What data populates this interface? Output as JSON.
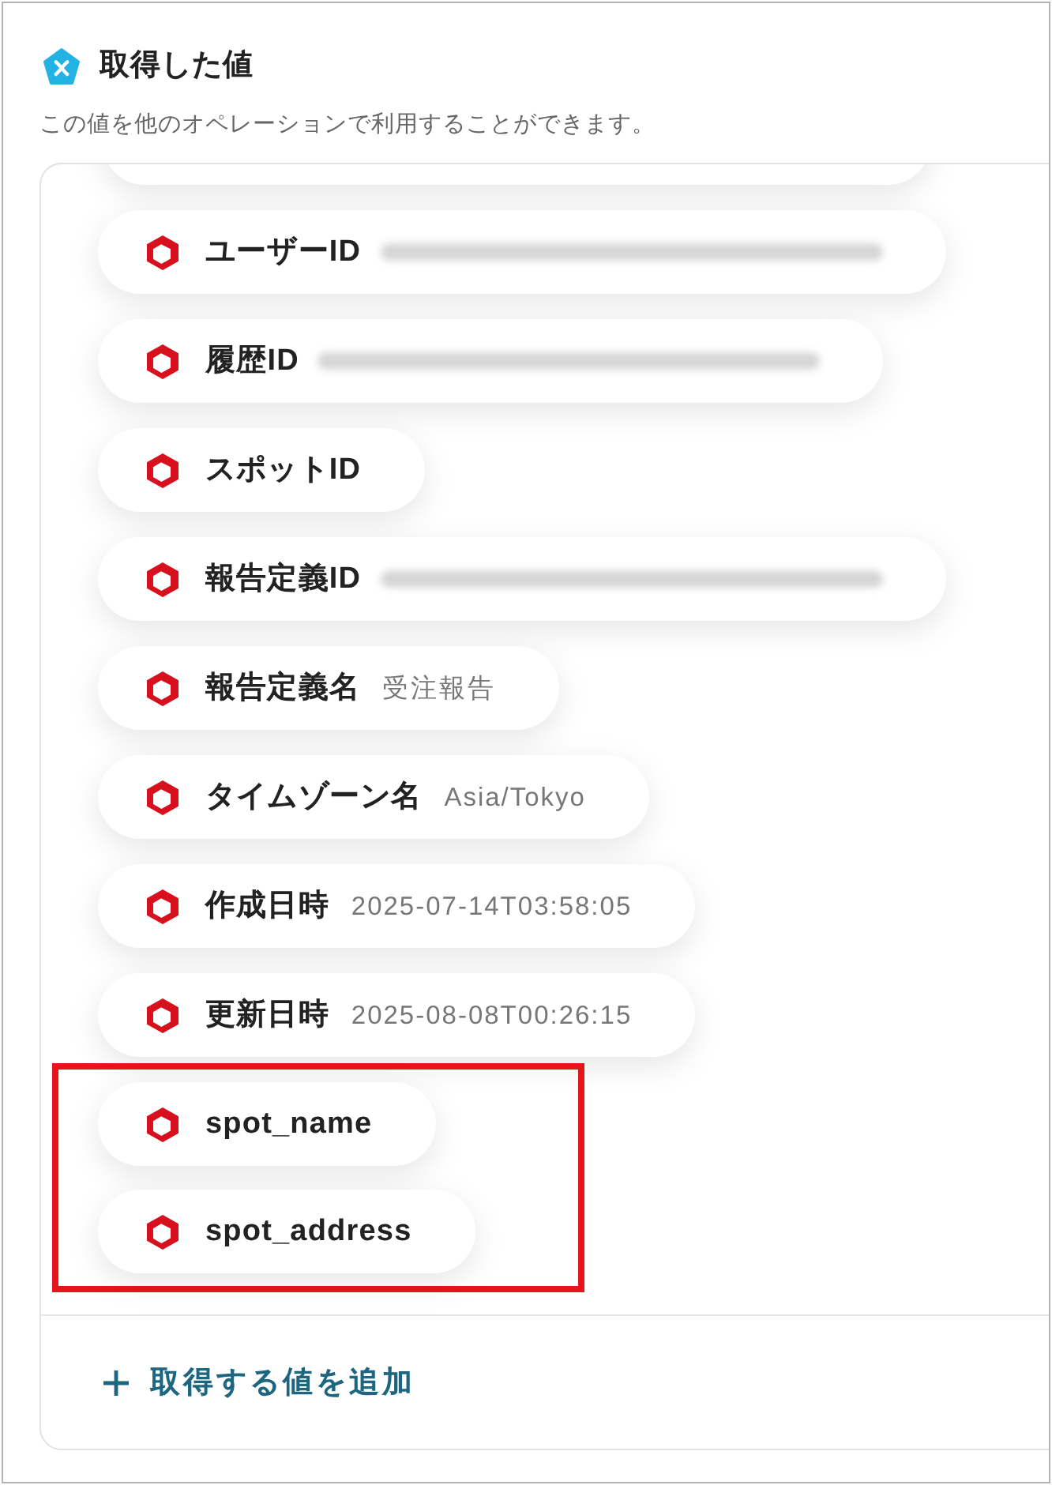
{
  "header": {
    "title": "取得した値",
    "description": "この値を他のオペレーションで利用することができます。"
  },
  "fields": [
    {
      "label": "ユーザーID",
      "value_blurred": true,
      "highlighted": false
    },
    {
      "label": "履歴ID",
      "value_blurred": true,
      "highlighted": false
    },
    {
      "label": "スポットID",
      "value_blurred": false,
      "highlighted": false
    },
    {
      "label": "報告定義ID",
      "value_blurred": true,
      "highlighted": false
    },
    {
      "label": "報告定義名",
      "value": "受注報告",
      "value_blurred": false,
      "highlighted": false
    },
    {
      "label": "タイムゾーン名",
      "value": "Asia/Tokyo",
      "value_blurred": false,
      "highlighted": false
    },
    {
      "label": "作成日時",
      "value": "2025-07-14T03:58:05",
      "value_blurred": false,
      "highlighted": false
    },
    {
      "label": "更新日時",
      "value": "2025-08-08T00:26:15",
      "value_blurred": false,
      "highlighted": false
    },
    {
      "label": "spot_name",
      "value_blurred": false,
      "highlighted": true
    },
    {
      "label": "spot_address",
      "value_blurred": false,
      "highlighted": true
    }
  ],
  "add_button": {
    "label": "取得する値を追加"
  }
}
